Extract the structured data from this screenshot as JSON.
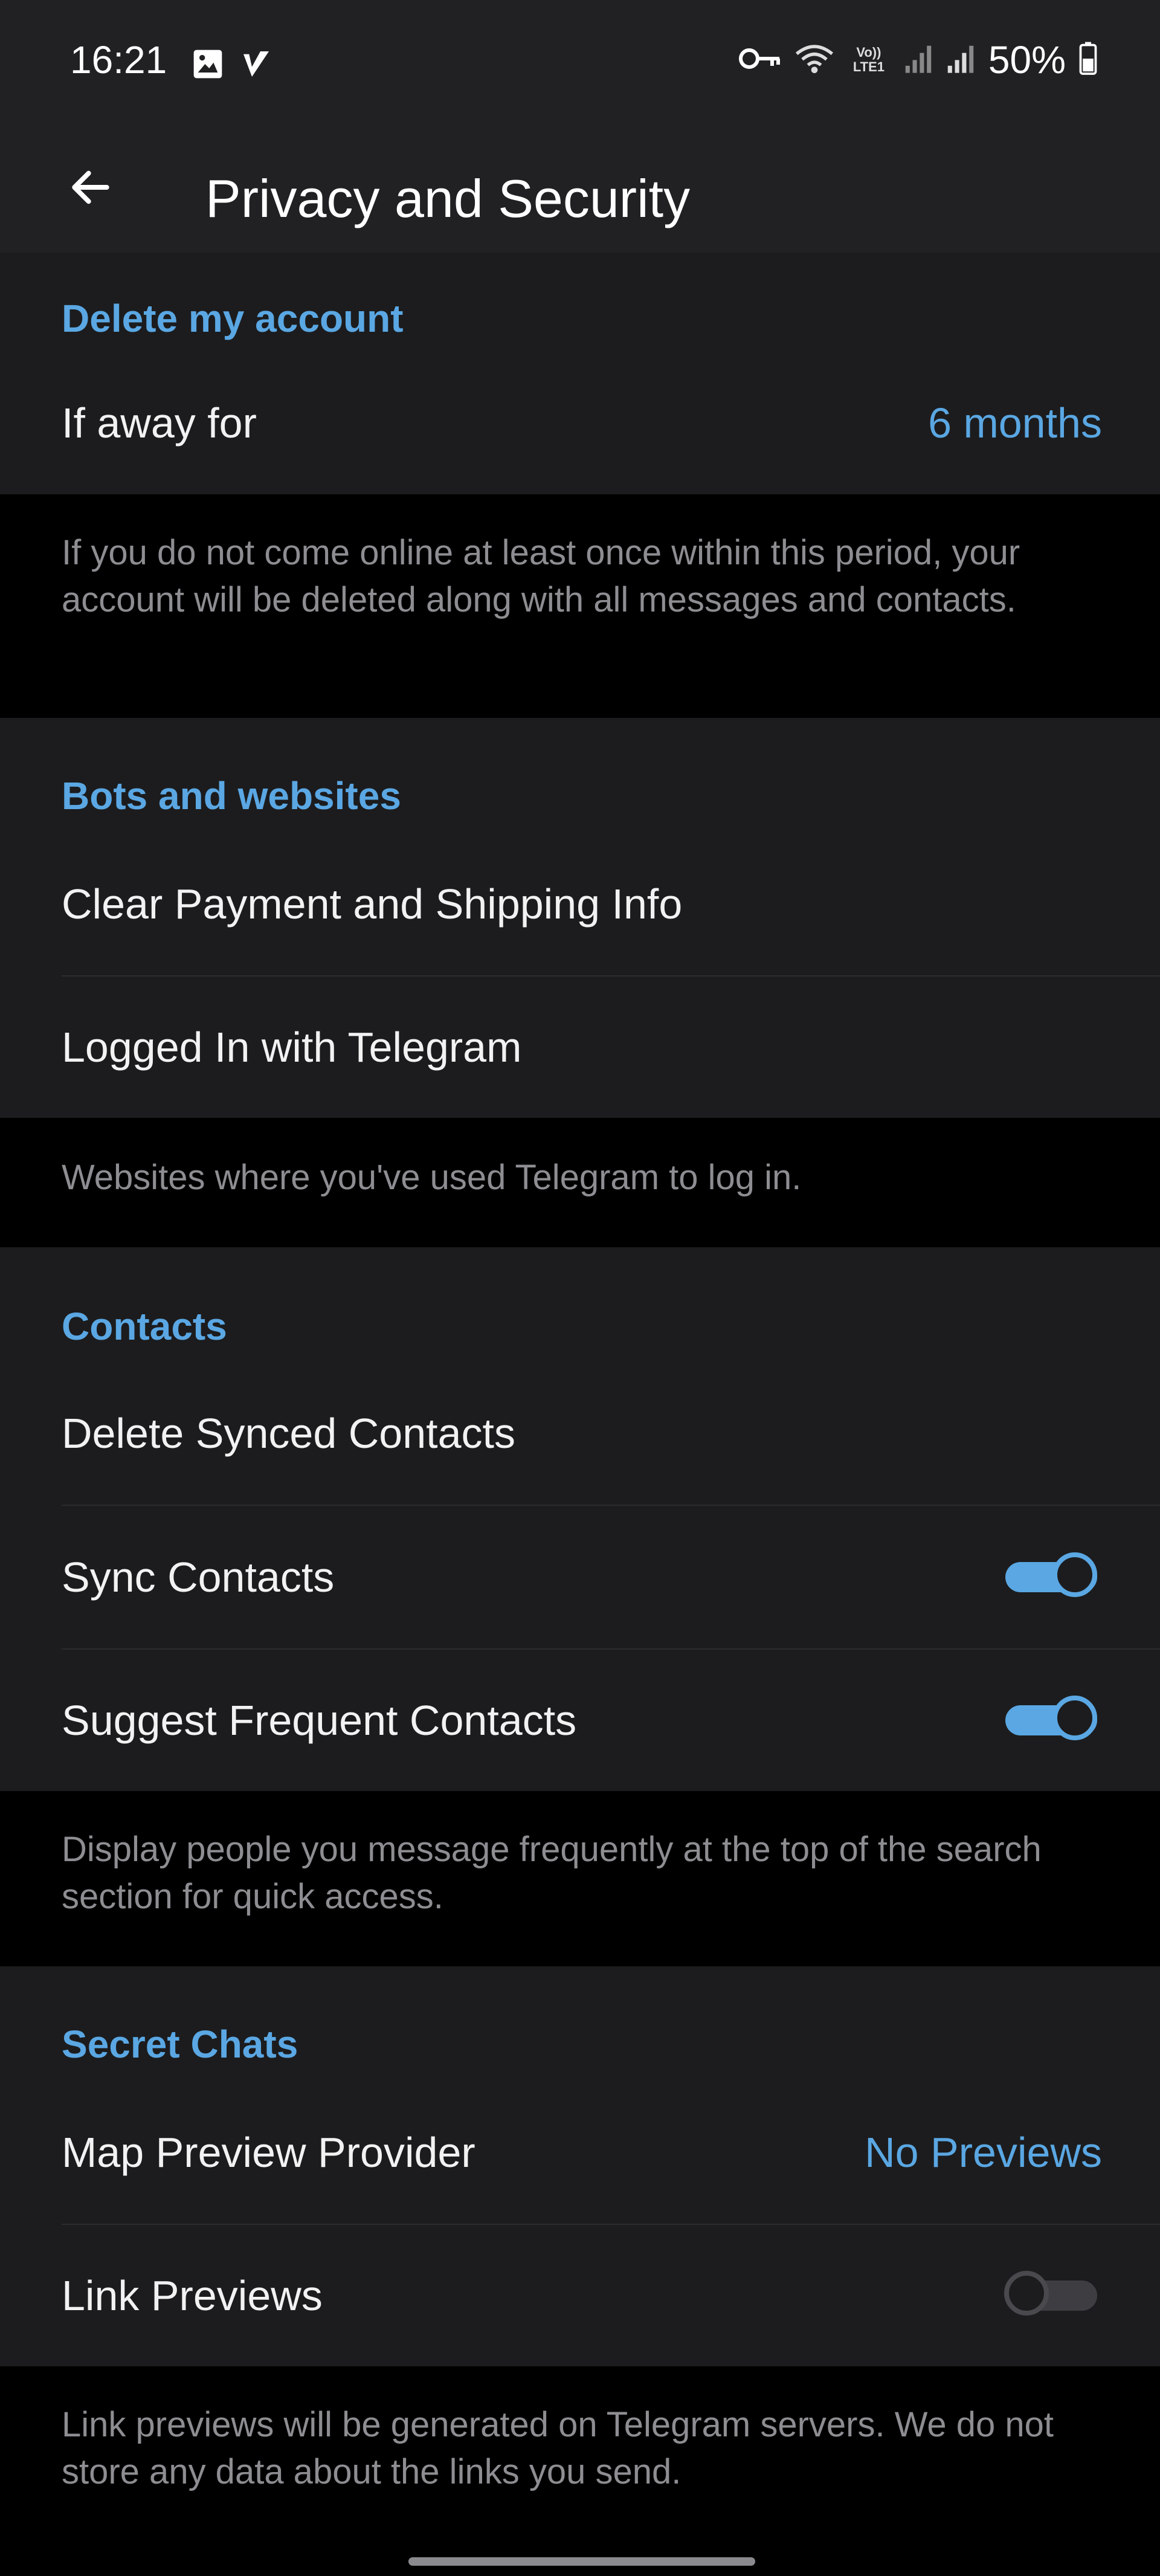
{
  "status_bar": {
    "time": "16:21",
    "battery": "50%",
    "left_icons": [
      "image-icon",
      "check-mark-icon"
    ],
    "right_icons": [
      "key-icon",
      "wifi-icon",
      "volte-lte-icon",
      "signal-1-icon",
      "signal-2-icon",
      "battery-icon"
    ],
    "volte_label": "Vo)) LTE1"
  },
  "app_bar": {
    "title": "Privacy and Security",
    "back_icon": "arrow-left-icon"
  },
  "delete_account": {
    "header": "Delete my account",
    "row_label": "If away for",
    "row_value": "6 months",
    "hint": "If you do not come online at least once within this period, your account will be deleted along with all messages and contacts."
  },
  "bots": {
    "header": "Bots and websites",
    "items": [
      {
        "label": "Clear Payment and Shipping Info"
      },
      {
        "label": "Logged In with Telegram"
      }
    ],
    "hint": "Websites where you've used Telegram to log in."
  },
  "contacts": {
    "header": "Contacts",
    "items": [
      {
        "label": "Delete Synced Contacts"
      },
      {
        "label": "Sync Contacts",
        "toggle": true
      },
      {
        "label": "Suggest Frequent Contacts",
        "toggle": true
      }
    ],
    "hint": "Display people you message frequently at the top of the search section for quick access."
  },
  "secret_chats": {
    "header": "Secret Chats",
    "items": [
      {
        "label": "Map Preview Provider",
        "value": "No Previews"
      },
      {
        "label": "Link Previews",
        "toggle": false
      }
    ],
    "hint": "Link previews will be generated on Telegram servers. We do not store any data about the links you send."
  },
  "colors": {
    "accent": "#5aa7e3",
    "section_bg": "#1c1c1e",
    "hint_bg": "#000000",
    "hint_text": "#8d8d92"
  }
}
